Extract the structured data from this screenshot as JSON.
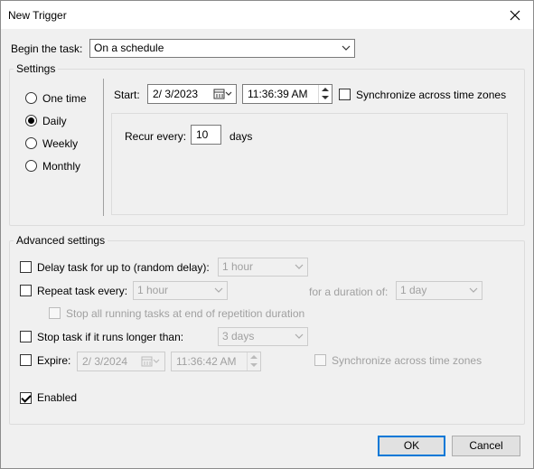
{
  "window": {
    "title": "New Trigger"
  },
  "begin": {
    "label": "Begin the task:",
    "value": "On a schedule"
  },
  "settings": {
    "title": "Settings",
    "radios": [
      {
        "label": "One time",
        "checked": false
      },
      {
        "label": "Daily",
        "checked": true
      },
      {
        "label": "Weekly",
        "checked": false
      },
      {
        "label": "Monthly",
        "checked": false
      }
    ],
    "start_label": "Start:",
    "start_date": "2/  3/2023",
    "start_time": "11:36:39 AM",
    "sync_label": "Synchronize across time zones",
    "recur_label": "Recur every:",
    "recur_value": "10",
    "recur_unit": "days"
  },
  "advanced": {
    "title": "Advanced settings",
    "delay_label": "Delay task for up to (random delay):",
    "delay_value": "1 hour",
    "repeat_label": "Repeat task every:",
    "repeat_value": "1 hour",
    "duration_label": "for a duration of:",
    "duration_value": "1 day",
    "stop_all_label": "Stop all running tasks at end of repetition duration",
    "stop_longer_label": "Stop task if it runs longer than:",
    "stop_longer_value": "3 days",
    "expire_label": "Expire:",
    "expire_date": "2/  3/2024",
    "expire_time": "11:36:42 AM",
    "expire_sync_label": "Synchronize across time zones",
    "enabled_label": "Enabled"
  },
  "buttons": {
    "ok": "OK",
    "cancel": "Cancel"
  },
  "colors": {
    "accent": "#0078d7",
    "disabled_text": "#a0a0a0"
  }
}
